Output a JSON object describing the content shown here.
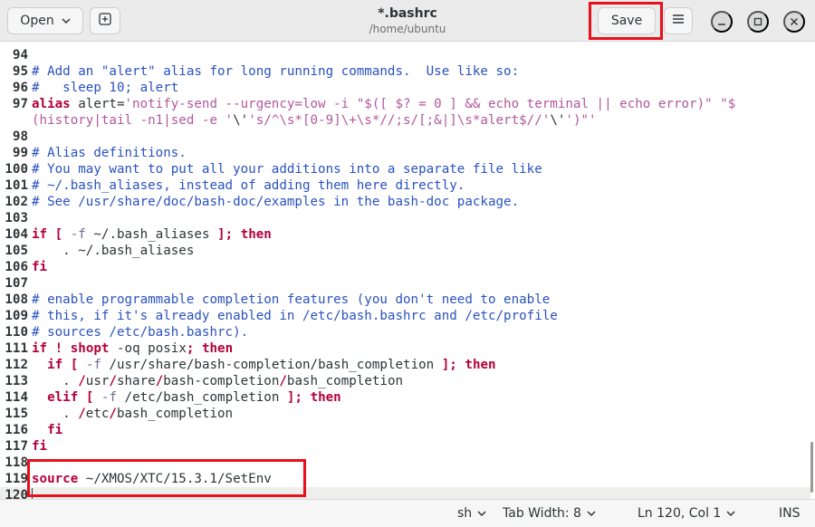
{
  "header": {
    "open_label": "Open",
    "save_label": "Save",
    "title": "*.bashrc",
    "subtitle": "/home/ubuntu",
    "icons": [
      "chevron-down-icon",
      "new-tab-icon",
      "hamburger-menu-icon",
      "minimize-icon",
      "maximize-icon",
      "close-icon"
    ]
  },
  "editor": {
    "lines": [
      {
        "n": "94",
        "spans": []
      },
      {
        "n": "95",
        "spans": [
          {
            "c": "com",
            "t": "# Add an \"alert\" alias for long running commands.  Use like so:"
          }
        ]
      },
      {
        "n": "96",
        "spans": [
          {
            "c": "com",
            "t": "#   sleep 10; alert"
          }
        ]
      },
      {
        "n": "97",
        "spans": [
          {
            "c": "kw",
            "t": "alias"
          },
          {
            "c": "",
            "t": " alert="
          },
          {
            "c": "str",
            "t": "'notify-send --urgency=low -i \"$([ $? = 0 ] && echo terminal || echo error)\" \"$"
          }
        ]
      },
      {
        "n": "",
        "spans": [
          {
            "c": "str",
            "t": "(history|tail -n1|sed -e '"
          },
          {
            "c": "",
            "t": "\\'"
          },
          {
            "c": "str",
            "t": "'s/^\\s*[0-9]\\+\\s*//;s/[;&|]\\s*alert$//'"
          },
          {
            "c": "",
            "t": "\\'"
          },
          {
            "c": "str",
            "t": "')\"'"
          }
        ]
      },
      {
        "n": "98",
        "spans": []
      },
      {
        "n": "99",
        "spans": [
          {
            "c": "com",
            "t": "# Alias definitions."
          }
        ]
      },
      {
        "n": "100",
        "spans": [
          {
            "c": "com",
            "t": "# You may want to put all your additions into a separate file like"
          }
        ]
      },
      {
        "n": "101",
        "spans": [
          {
            "c": "com",
            "t": "# ~/.bash_aliases, instead of adding them here directly."
          }
        ]
      },
      {
        "n": "102",
        "spans": [
          {
            "c": "com",
            "t": "# See /usr/share/doc/bash-doc/examples in the bash-doc package."
          }
        ]
      },
      {
        "n": "103",
        "spans": []
      },
      {
        "n": "104",
        "spans": [
          {
            "c": "kw",
            "t": "if"
          },
          {
            "c": "",
            "t": " "
          },
          {
            "c": "kw",
            "t": "["
          },
          {
            "c": "",
            "t": " "
          },
          {
            "c": "op",
            "t": "-f"
          },
          {
            "c": "",
            "t": " ~/.bash_aliases "
          },
          {
            "c": "kw",
            "t": "];"
          },
          {
            "c": "",
            "t": " "
          },
          {
            "c": "kw",
            "t": "then"
          }
        ]
      },
      {
        "n": "105",
        "spans": [
          {
            "c": "",
            "t": "    . ~/.bash_aliases"
          }
        ]
      },
      {
        "n": "106",
        "spans": [
          {
            "c": "kw",
            "t": "fi"
          }
        ]
      },
      {
        "n": "107",
        "spans": []
      },
      {
        "n": "108",
        "spans": [
          {
            "c": "com",
            "t": "# enable programmable completion features (you don't need to enable"
          }
        ]
      },
      {
        "n": "109",
        "spans": [
          {
            "c": "com",
            "t": "# this, if it's already enabled in /etc/bash.bashrc and /etc/profile"
          }
        ]
      },
      {
        "n": "110",
        "spans": [
          {
            "c": "com",
            "t": "# sources /etc/bash.bashrc)."
          }
        ]
      },
      {
        "n": "111",
        "spans": [
          {
            "c": "kw",
            "t": "if"
          },
          {
            "c": "",
            "t": " "
          },
          {
            "c": "kw",
            "t": "!"
          },
          {
            "c": "",
            "t": " "
          },
          {
            "c": "kw",
            "t": "shopt"
          },
          {
            "c": "",
            "t": " -oq posix"
          },
          {
            "c": "kw",
            "t": ";"
          },
          {
            "c": "",
            "t": " "
          },
          {
            "c": "kw",
            "t": "then"
          }
        ]
      },
      {
        "n": "112",
        "spans": [
          {
            "c": "",
            "t": "  "
          },
          {
            "c": "kw",
            "t": "if"
          },
          {
            "c": "",
            "t": " "
          },
          {
            "c": "kw",
            "t": "["
          },
          {
            "c": "",
            "t": " "
          },
          {
            "c": "op",
            "t": "-f"
          },
          {
            "c": "",
            "t": " /usr/share/bash-completion/bash_completion "
          },
          {
            "c": "kw",
            "t": "];"
          },
          {
            "c": "",
            "t": " "
          },
          {
            "c": "kw",
            "t": "then"
          }
        ]
      },
      {
        "n": "113",
        "spans": [
          {
            "c": "",
            "t": "    . "
          },
          {
            "c": "kw",
            "t": "/"
          },
          {
            "c": "",
            "t": "usr"
          },
          {
            "c": "kw",
            "t": "/"
          },
          {
            "c": "",
            "t": "share"
          },
          {
            "c": "kw",
            "t": "/"
          },
          {
            "c": "",
            "t": "bash-completion"
          },
          {
            "c": "kw",
            "t": "/"
          },
          {
            "c": "",
            "t": "bash_completion"
          }
        ]
      },
      {
        "n": "114",
        "spans": [
          {
            "c": "",
            "t": "  "
          },
          {
            "c": "kw",
            "t": "elif"
          },
          {
            "c": "",
            "t": " "
          },
          {
            "c": "kw",
            "t": "["
          },
          {
            "c": "",
            "t": " "
          },
          {
            "c": "op",
            "t": "-f"
          },
          {
            "c": "",
            "t": " /etc/bash_completion "
          },
          {
            "c": "kw",
            "t": "];"
          },
          {
            "c": "",
            "t": " "
          },
          {
            "c": "kw",
            "t": "then"
          }
        ]
      },
      {
        "n": "115",
        "spans": [
          {
            "c": "",
            "t": "    . "
          },
          {
            "c": "kw",
            "t": "/"
          },
          {
            "c": "",
            "t": "etc"
          },
          {
            "c": "kw",
            "t": "/"
          },
          {
            "c": "",
            "t": "bash_completion"
          }
        ]
      },
      {
        "n": "116",
        "spans": [
          {
            "c": "",
            "t": "  "
          },
          {
            "c": "kw",
            "t": "fi"
          }
        ]
      },
      {
        "n": "117",
        "spans": [
          {
            "c": "kw",
            "t": "fi"
          }
        ]
      },
      {
        "n": "118",
        "spans": []
      },
      {
        "n": "119",
        "spans": [
          {
            "c": "kw",
            "t": "source"
          },
          {
            "c": "",
            "t": " ~/XMOS/XTC/15.3.1/SetEnv"
          }
        ]
      },
      {
        "n": "120",
        "spans": []
      }
    ]
  },
  "statusbar": {
    "language": "sh",
    "tab_width": "Tab Width: 8",
    "position": "Ln 120, Col 1",
    "mode": "INS"
  },
  "colors": {
    "comment": "#2a52be",
    "keyword": "#b5003a",
    "string": "#b1589c",
    "annotation": "#e8101a"
  }
}
